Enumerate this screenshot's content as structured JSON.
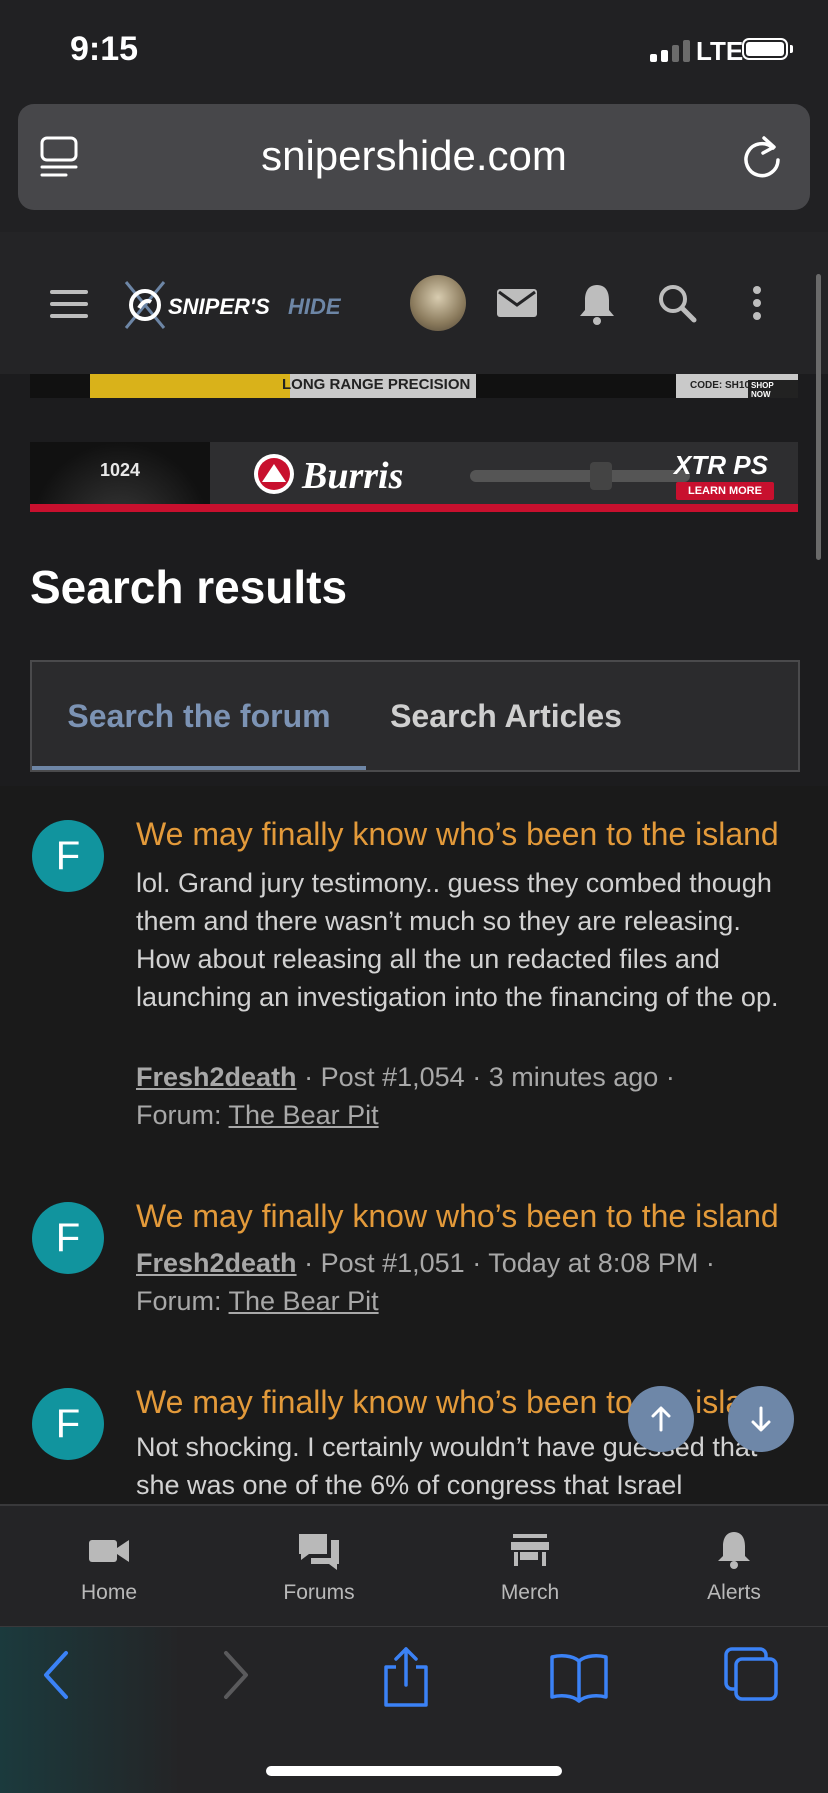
{
  "status_bar": {
    "time": "9:15",
    "network": "LTE"
  },
  "browser": {
    "url": "snipershide.com"
  },
  "site": {
    "logo_text": "SNIPER'S HIDE"
  },
  "ads": {
    "ad1": {
      "text": "LONG RANGE PRECISION",
      "code": "CODE: SH10",
      "cta": "SHOP NOW"
    },
    "ad2": {
      "brand": "Burris",
      "product": "XTR PS",
      "cta": "LEARN MORE",
      "readout": "1024"
    }
  },
  "page": {
    "title": "Search results",
    "tabs": [
      {
        "label": "Search the forum",
        "active": true
      },
      {
        "label": "Search Articles",
        "active": false
      }
    ]
  },
  "results": [
    {
      "avatar_letter": "F",
      "title": "We may finally know who’s been to the island",
      "snippet": "lol. Grand jury testimony.. guess they combed though them and there wasn’t much so they are releasing. How about releasing all the un redacted files and launching an investigation into the financing of the op.",
      "user": "Fresh2death",
      "post": "Post #1,054",
      "time": "3 minutes ago",
      "forum_label": "Forum:",
      "forum": "The Bear Pit"
    },
    {
      "avatar_letter": "F",
      "title": "We may finally know who’s been to the island",
      "snippet": "",
      "user": "Fresh2death",
      "post": "Post #1,051",
      "time": "Today at 8:08 PM",
      "forum_label": "Forum:",
      "forum": "The Bear Pit"
    },
    {
      "avatar_letter": "F",
      "title": "We may finally know who’s been to the island",
      "snippet": "Not shocking. I certainly wouldn’t have guessed that she was one of the 6% of congress that Israel"
    }
  ],
  "bottom_nav": [
    {
      "label": "Home",
      "icon": "video-camera-icon"
    },
    {
      "label": "Forums",
      "icon": "chat-bubbles-icon"
    },
    {
      "label": "Merch",
      "icon": "store-icon"
    },
    {
      "label": "Alerts",
      "icon": "bell-icon"
    }
  ],
  "colors": {
    "accent_link": "#e39a3a",
    "tab_active": "#7c93b4",
    "avatar": "#11949e",
    "ios_blue": "#3b82f6"
  }
}
